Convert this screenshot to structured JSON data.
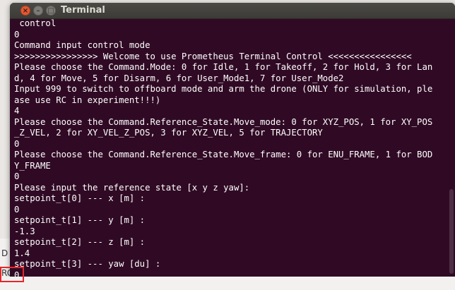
{
  "window": {
    "title": "Terminal",
    "close_glyph": "×",
    "min_glyph": "–",
    "max_glyph": "□"
  },
  "background_window": {
    "fragment_1": "D T",
    "fragment_2": "RC"
  },
  "terminal": {
    "lines": [
      " control",
      "0",
      "Command input control mode",
      ">>>>>>>>>>>>>>>> Welcome to use Prometheus Terminal Control <<<<<<<<<<<<<<<<",
      "Please choose the Command.Mode: 0 for Idle, 1 for Takeoff, 2 for Hold, 3 for Lan",
      "d, 4 for Move, 5 for Disarm, 6 for User_Mode1, 7 for User_Mode2",
      "Input 999 to switch to offboard mode and arm the drone (ONLY for simulation, ple",
      "ase use RC in experiment!!!)",
      "4",
      "Please choose the Command.Reference_State.Move_mode: 0 for XYZ_POS, 1 for XY_POS",
      "_Z_VEL, 2 for XY_VEL_Z_POS, 3 for XYZ_VEL, 5 for TRAJECTORY",
      "0",
      "Please choose the Command.Reference_State.Move_frame: 0 for ENU_FRAME, 1 for BOD",
      "Y_FRAME",
      "0",
      "Please input the reference state [x y z yaw]:",
      "setpoint_t[0] --- x [m] :",
      "0",
      "setpoint_t[1] --- y [m] :",
      "-1.3",
      "setpoint_t[2] --- z [m] :",
      "1.4",
      "setpoint_t[3] --- yaw [du] :",
      "0"
    ]
  },
  "colors": {
    "terminal_bg": "#300a24",
    "text": "#ffffff",
    "highlight_box": "#e8262b"
  },
  "icons": [
    "close-icon",
    "minimize-icon",
    "maximize-icon"
  ]
}
